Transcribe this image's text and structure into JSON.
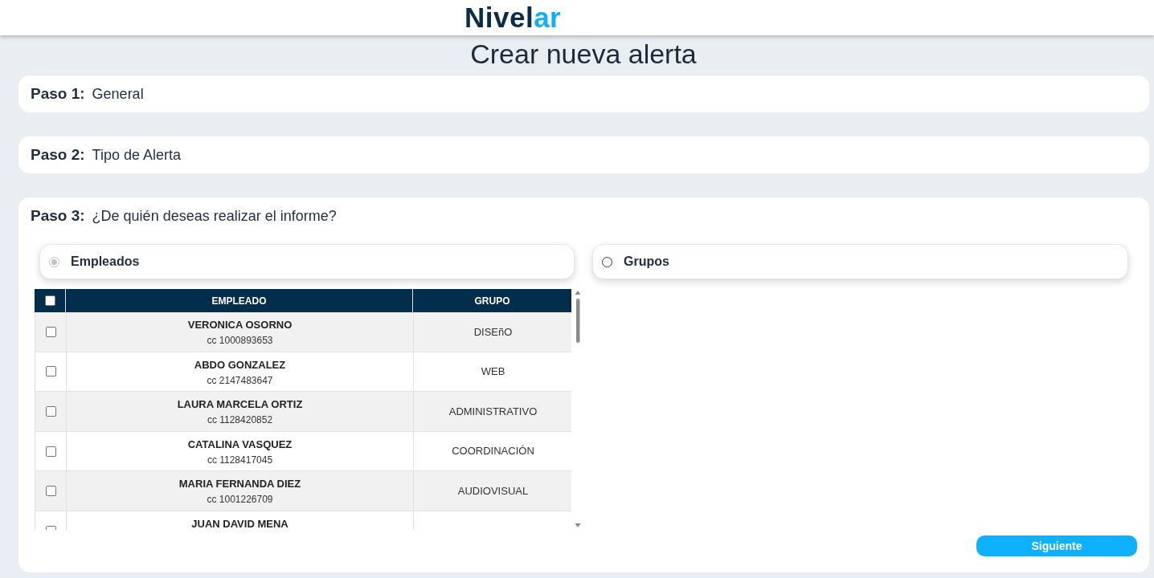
{
  "header": {
    "logo": {
      "parts": [
        {
          "text": "Nivel",
          "color": "#0b2c47"
        },
        {
          "text": "ar",
          "color": "#12aef7"
        }
      ]
    }
  },
  "page_title": "Crear nueva alerta",
  "steps": [
    {
      "label": "Paso 1:",
      "title": "General",
      "expanded": false
    },
    {
      "label": "Paso 2:",
      "title": "Tipo de Alerta",
      "expanded": false
    },
    {
      "label": "Paso 3:",
      "title": "¿De quién deseas realizar el informe?",
      "expanded": true
    }
  ],
  "recipients": {
    "options": [
      {
        "label": "Empleados",
        "selected": true,
        "disabled": true,
        "table": {
          "select_all": {
            "checked": false
          },
          "columns": [
            "EMPLEADO",
            "GRUPO"
          ],
          "rows": [
            {
              "checked": false,
              "name": "VERONICA OSORNO",
              "document": "cc 1000893653",
              "group": "DISEñO"
            },
            {
              "checked": false,
              "name": "ABDO GONZALEZ",
              "document": "cc 2147483647",
              "group": "WEB"
            },
            {
              "checked": false,
              "name": "LAURA MARCELA ORTIZ",
              "document": "cc 1128420852",
              "group": "ADMINISTRATIVO"
            },
            {
              "checked": false,
              "name": "CATALINA VASQUEZ",
              "document": "cc 1128417045",
              "group": "COORDINACIÓN"
            },
            {
              "checked": false,
              "name": "MARIA FERNANDA DIEZ",
              "document": "cc 1001226709",
              "group": "AUDIOVISUAL"
            },
            {
              "checked": false,
              "name": "JUAN DAVID MENA"
            }
          ]
        }
      },
      {
        "label": "Grupos",
        "selected": false,
        "disabled": false
      }
    ],
    "next_button": "Siguiente"
  }
}
